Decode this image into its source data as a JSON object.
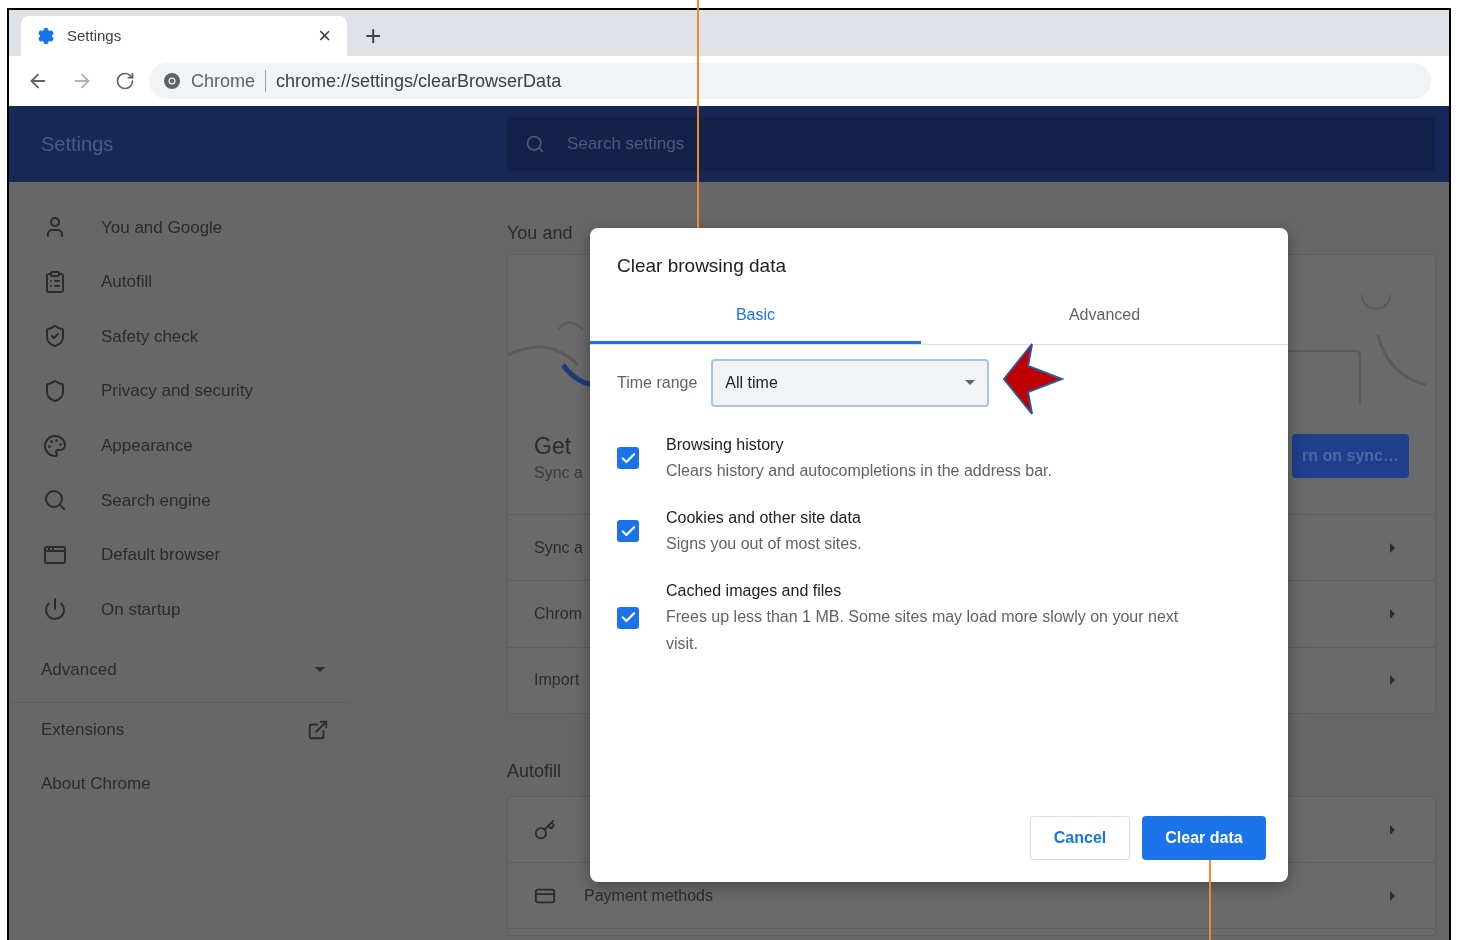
{
  "browser_tab": {
    "title": "Settings",
    "close": "×",
    "new_tab": "+"
  },
  "address_bar": {
    "site": "Chrome",
    "url": "chrome://settings/clearBrowserData"
  },
  "header": {
    "title": "Settings",
    "search": {
      "placeholder": "Search settings"
    }
  },
  "sidebar": {
    "items": [
      {
        "label": "You and Google"
      },
      {
        "label": "Autofill"
      },
      {
        "label": "Safety check"
      },
      {
        "label": "Privacy and security"
      },
      {
        "label": "Appearance"
      },
      {
        "label": "Search engine"
      },
      {
        "label": "Default browser"
      },
      {
        "label": "On startup"
      }
    ],
    "advanced": {
      "label": "Advanced",
      "expanded": false
    },
    "links": [
      {
        "label": "Extensions",
        "external": true
      },
      {
        "label": "About Chrome",
        "external": false
      }
    ]
  },
  "main": {
    "section_1": {
      "heading": "You and",
      "card_title": "Get",
      "card_text": "Sync a",
      "sync_button": "rn on sync…",
      "rows": [
        "Sync a",
        "Chrom",
        "Import"
      ]
    },
    "section_2": {
      "heading": "Autofill",
      "rows": [
        {
          "kind": "key"
        },
        {
          "kind": "card",
          "label": "Payment methods"
        }
      ]
    }
  },
  "dialog": {
    "title": "Clear browsing data",
    "tabs": [
      {
        "label": "Basic",
        "selected": true
      },
      {
        "label": "Advanced",
        "selected": false
      }
    ],
    "time_range": {
      "label": "Time range",
      "value": "All time"
    },
    "options": [
      {
        "title": "Browsing history",
        "description": "Clears history and autocompletions in the address bar.",
        "checked": true
      },
      {
        "title": "Cookies and other site data",
        "description": "Signs you out of most sites.",
        "checked": true
      },
      {
        "title": "Cached images and files",
        "description": "Frees up less than 1 MB. Some sites may load more slowly on your next visit.",
        "checked": true
      }
    ],
    "buttons": {
      "cancel": "Cancel",
      "confirm": "Clear data"
    }
  }
}
